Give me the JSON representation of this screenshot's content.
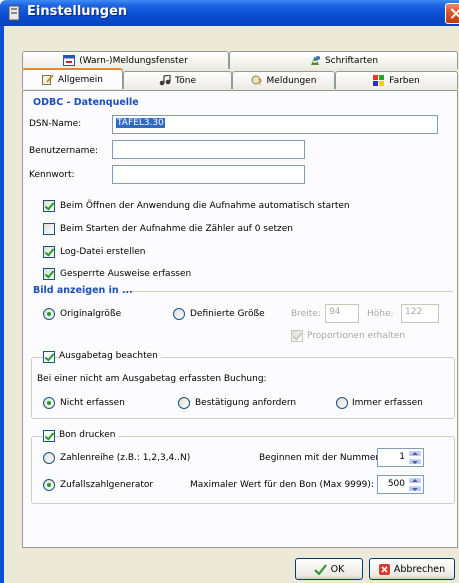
{
  "window": {
    "title": "Einstellungen"
  },
  "tabs_top": [
    {
      "label": "(Warn-)Meldungsfenster",
      "icon": "warning-window-icon"
    },
    {
      "label": "Schriftarten",
      "icon": "fonts-icon"
    }
  ],
  "tabs_bottom": [
    {
      "label": "Allgemein",
      "icon": "general-settings-icon",
      "active": true
    },
    {
      "label": "Töne",
      "icon": "sounds-icon"
    },
    {
      "label": "Meldungen",
      "icon": "messages-icon"
    },
    {
      "label": "Farben",
      "icon": "colors-icon"
    }
  ],
  "odbc": {
    "title": "ODBC - Datenquelle",
    "dsn_label": "DSN-Name:",
    "dsn_value": "TAFEL3.30",
    "user_label": "Benutzername:",
    "user_value": "",
    "password_label": "Kennwort:",
    "password_value": ""
  },
  "options": {
    "autostart": {
      "label": "Beim Öffnen der Anwendung die Aufnahme automatisch starten",
      "checked": true
    },
    "reset_counter": {
      "label": "Beim Starten der Aufnahme die Zähler auf 0 setzen",
      "checked": false
    },
    "log_file": {
      "label": "Log-Datei erstellen",
      "checked": true
    },
    "blocked_ids": {
      "label": "Gesperrte Ausweise erfassen",
      "checked": true
    }
  },
  "image": {
    "title": "Bild anzeigen in ...",
    "original_label": "Originalgröße",
    "defined_label": "Definierte Größe",
    "width_label": "Breite:",
    "width_value": "94",
    "height_label": "Höhe:",
    "height_value": "122",
    "proportions_label": "Proportionen erhalten",
    "selected": "Originalgröße"
  },
  "issue_day": {
    "checkbox_label": "Ausgabetag beachten",
    "checked": true,
    "question": "Bei einer nicht am Ausgabetag erfassten Buchung:",
    "opt_none": "Nicht erfassen",
    "opt_confirm": "Bestätigung anfordern",
    "opt_always": "Immer erfassen",
    "selected": "Nicht erfassen"
  },
  "receipt": {
    "checkbox_label": "Bon drucken",
    "checked": true,
    "sequence_label": "Zahlenreihe (z.B.: 1,2,3,4..N)",
    "start_label": "Beginnen mit der Nummer:",
    "start_value": "1",
    "random_label": "Zufallszahlgenerator",
    "max_label": "Maximaler Wert für den Bon (Max 9999):",
    "max_value": "500",
    "selected": "Zufallszahlgenerator"
  },
  "buttons": {
    "ok": "OK",
    "cancel": "Abbrechen"
  }
}
